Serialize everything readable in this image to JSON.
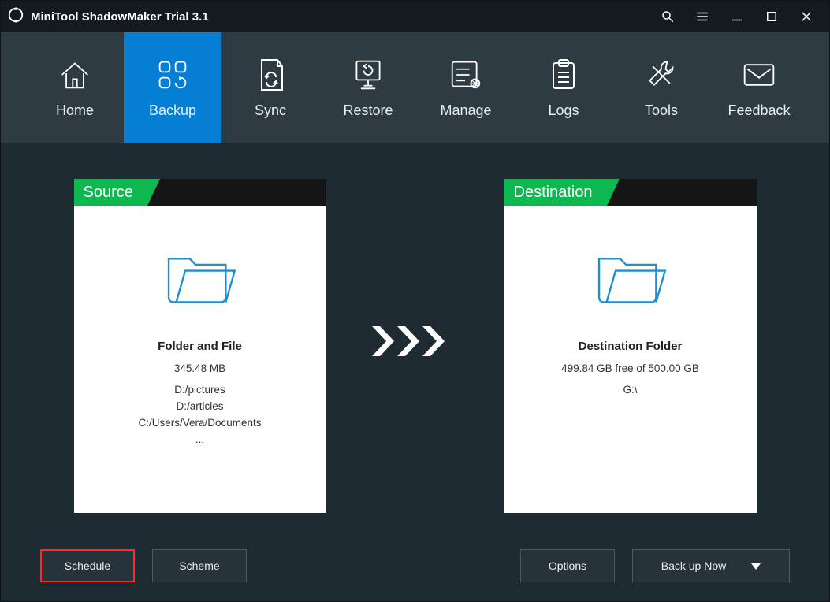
{
  "app": {
    "title": "MiniTool ShadowMaker Trial 3.1"
  },
  "nav": {
    "home": "Home",
    "backup": "Backup",
    "sync": "Sync",
    "restore": "Restore",
    "manage": "Manage",
    "logs": "Logs",
    "tools": "Tools",
    "feedback": "Feedback"
  },
  "source": {
    "header": "Source",
    "title": "Folder and File",
    "size": "345.48 MB",
    "paths": [
      "D:/pictures",
      "D:/articles",
      "C:/Users/Vera/Documents",
      "..."
    ]
  },
  "destination": {
    "header": "Destination",
    "title": "Destination Folder",
    "space": "499.84 GB free of 500.00 GB",
    "drive": "G:\\"
  },
  "buttons": {
    "schedule": "Schedule",
    "scheme": "Scheme",
    "options": "Options",
    "backup_now": "Back up Now"
  }
}
